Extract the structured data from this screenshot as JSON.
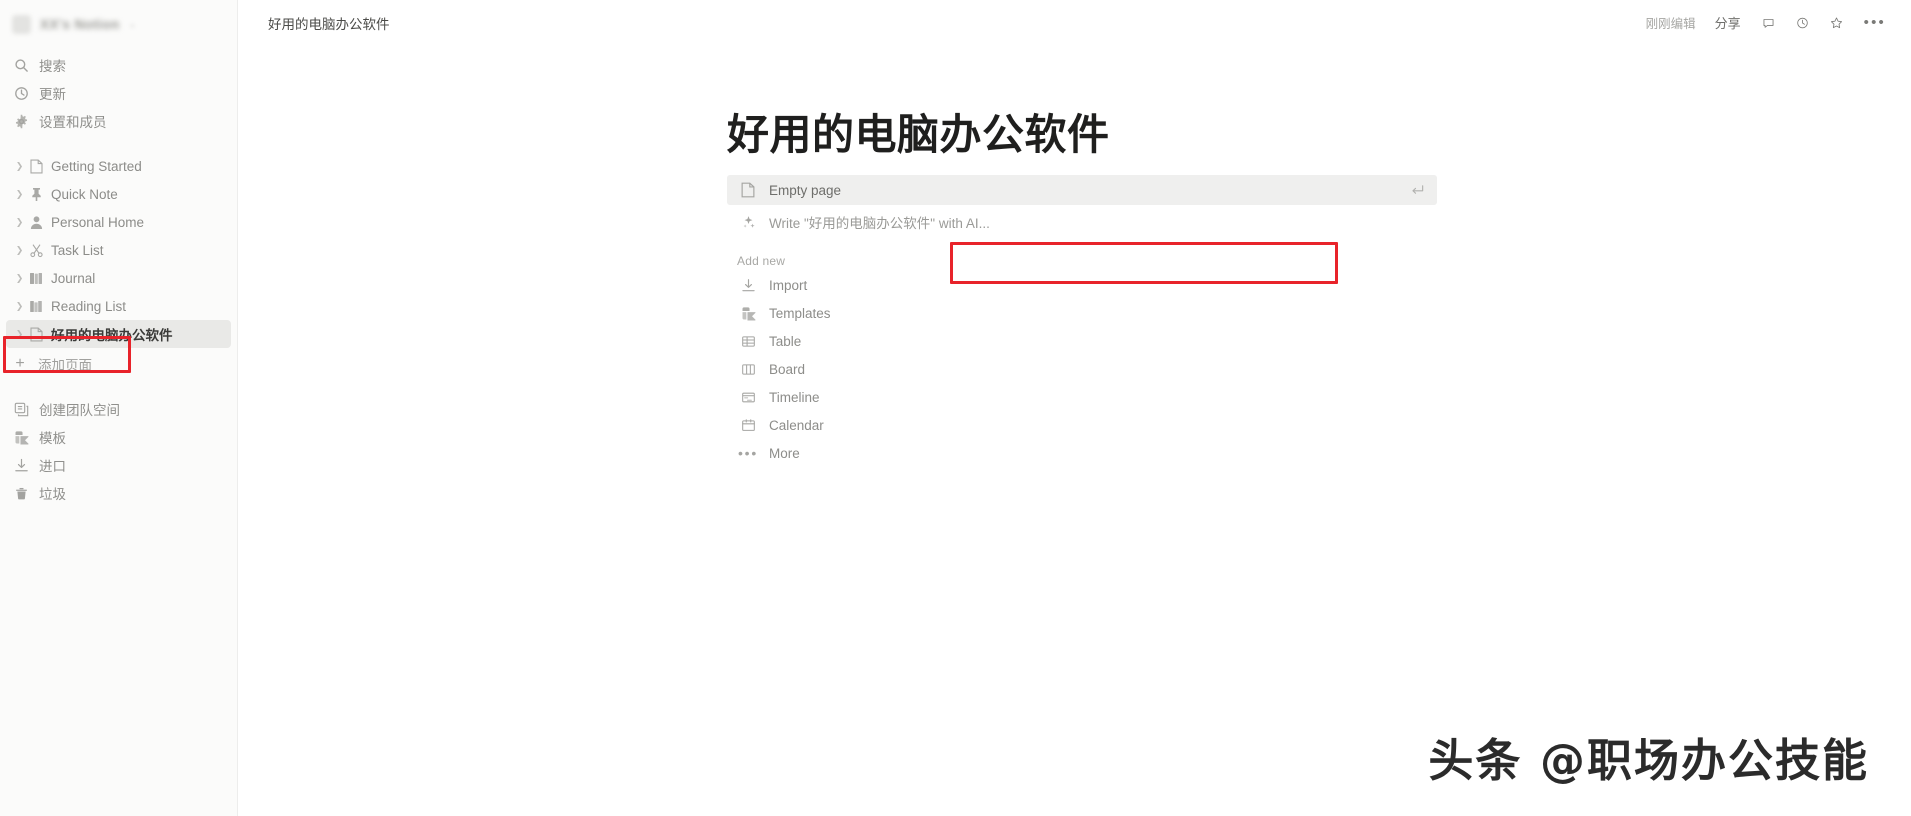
{
  "workspace": {
    "name": "XX's Notion",
    "caret": "⌄",
    "avatar_icon": "workspace-avatar"
  },
  "sidebar": {
    "nav": [
      {
        "label": "搜索",
        "icon": "search-icon"
      },
      {
        "label": "更新",
        "icon": "clock-icon"
      },
      {
        "label": "设置和成员",
        "icon": "gear-icon"
      }
    ],
    "pages": [
      {
        "label": "Getting Started",
        "icon": "document-icon",
        "active": false
      },
      {
        "label": "Quick Note",
        "icon": "pin-icon",
        "active": false
      },
      {
        "label": "Personal Home",
        "icon": "person-icon",
        "active": false
      },
      {
        "label": "Task List",
        "icon": "scissors-icon",
        "active": false
      },
      {
        "label": "Journal",
        "icon": "book-icon",
        "active": false
      },
      {
        "label": "Reading List",
        "icon": "books-icon",
        "active": false
      },
      {
        "label": "好用的电脑办公软件",
        "icon": "document-icon",
        "active": true
      }
    ],
    "add_page": {
      "label": "添加页面",
      "icon": "plus-icon"
    },
    "bottom": [
      {
        "label": "创建团队空间",
        "icon": "teamspace-icon"
      },
      {
        "label": "模板",
        "icon": "templates-icon"
      },
      {
        "label": "进口",
        "icon": "import-icon"
      },
      {
        "label": "垃圾",
        "icon": "trash-icon"
      }
    ]
  },
  "topbar": {
    "breadcrumb": "好用的电脑办公软件",
    "edited_label": "刚刚编辑",
    "share_label": "分享",
    "icons": [
      "comment-icon",
      "history-icon",
      "star-icon",
      "more-icon"
    ]
  },
  "page": {
    "title": "好用的电脑办公软件",
    "empty_page": {
      "label": "Empty page",
      "icon": "document-icon",
      "shortcut": "enter-key-icon"
    },
    "ai_row": {
      "label": "Write \"好用的电脑办公软件\" with AI...",
      "icon": "ai-sparkle-icon"
    },
    "add_new_label": "Add new",
    "add_new_items": [
      {
        "label": "Import",
        "icon": "import-icon"
      },
      {
        "label": "Templates",
        "icon": "templates-icon"
      },
      {
        "label": "Table",
        "icon": "table-icon"
      },
      {
        "label": "Board",
        "icon": "board-icon"
      },
      {
        "label": "Timeline",
        "icon": "timeline-icon"
      },
      {
        "label": "Calendar",
        "icon": "calendar-icon"
      },
      {
        "label": "More",
        "icon": "more-dots-icon"
      }
    ]
  },
  "watermark": {
    "text": "头条 @职场办公技能"
  },
  "colors": {
    "annotation_red": "#e8232a",
    "sidebar_bg": "#fbfbfa",
    "active_row_bg": "#e9e9e7",
    "ai_purple": "#8d72c9"
  }
}
